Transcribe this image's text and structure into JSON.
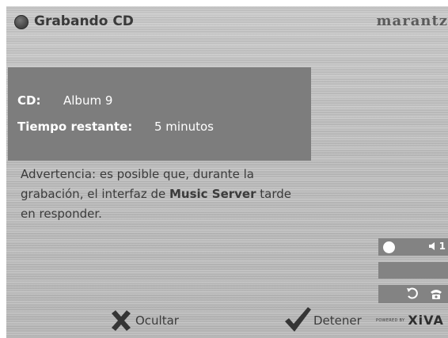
{
  "header": {
    "title": "Grabando CD",
    "brand": "marantz"
  },
  "info": {
    "cd_label": "CD:",
    "cd_value": "Album 9",
    "time_label": "Tiempo restante:",
    "time_value": "5 minutos"
  },
  "warning": {
    "text_before": "Advertencia: es posible que, durante la grabación, el interfaz de ",
    "bold": "Music Server",
    "text_after": " tarde en responder."
  },
  "side": {
    "volume_level": "1"
  },
  "bottom": {
    "hide_label": "Ocultar",
    "stop_label": "Detener",
    "powered_by": "POWERED BY",
    "xiva": "XiVA"
  },
  "colors": {
    "panel": "#7d7d7d",
    "background": "#c2c2c2",
    "text": "#3b3b3b",
    "side_button": "#838383"
  }
}
